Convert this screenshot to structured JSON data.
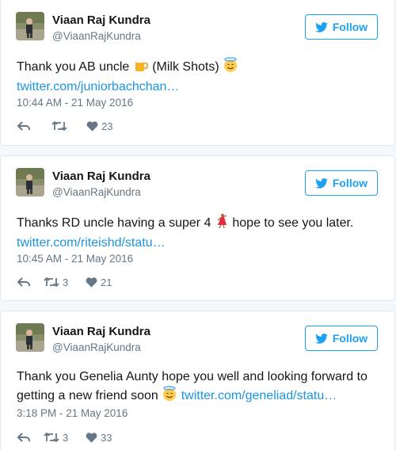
{
  "tweets": [
    {
      "name": "Viaan Raj Kundra",
      "handle": "@ViaanRajKundra",
      "follow_label": "Follow",
      "text_before": "Thank you AB uncle",
      "text_after": "(Milk Shots)",
      "emoji_1": "beer-mug-emoji",
      "emoji_2": "halo-smiley-emoji",
      "link": "twitter.com/juniorbachchan…",
      "timestamp": "10:44 AM - 21 May 2016",
      "retweets": "",
      "likes": "23"
    },
    {
      "name": "Viaan Raj Kundra",
      "handle": "@ViaanRajKundra",
      "follow_label": "Follow",
      "text_before": "Thanks RD uncle having a super 4",
      "text_after": "hope to see you later.",
      "emoji_1": "dancer-emoji",
      "link": "twitter.com/riteishd/statu…",
      "timestamp": "10:45 AM - 21 May 2016",
      "retweets": "3",
      "likes": "21"
    },
    {
      "name": "Viaan Raj Kundra",
      "handle": "@ViaanRajKundra",
      "follow_label": "Follow",
      "text_before": "Thank you Genelia Aunty hope you well and looking forward to getting a new friend soon",
      "emoji_1": "halo-smiley-emoji",
      "link": "twitter.com/geneliad/statu…",
      "timestamp": "3:18 PM - 21 May 2016",
      "retweets": "3",
      "likes": "33"
    }
  ],
  "colors": {
    "accent": "#1da1f2",
    "link": "#1b95e0",
    "muted": "#657786",
    "border": "#e1e8ed",
    "background": "#f5f8fa"
  }
}
